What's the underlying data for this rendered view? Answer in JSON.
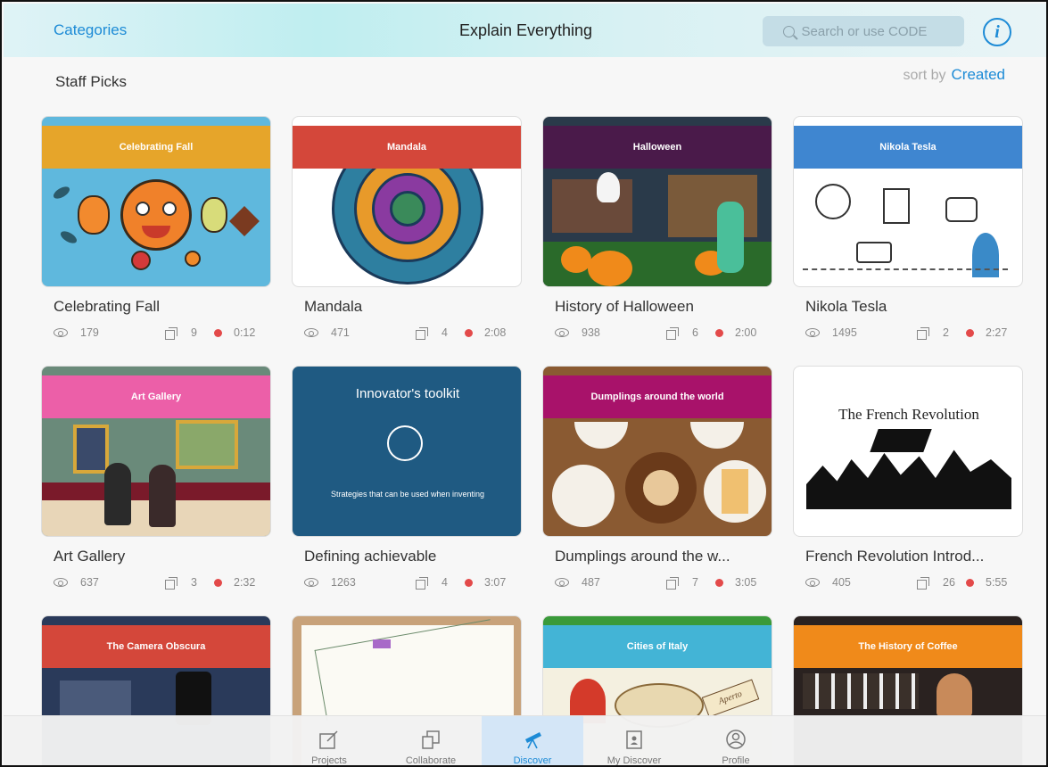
{
  "header": {
    "categories_label": "Categories",
    "title": "Explain Everything",
    "search_placeholder": "Search or use CODE"
  },
  "section": {
    "title": "Staff Picks",
    "sort_label": "sort by",
    "sort_value": "Created"
  },
  "cards": [
    {
      "banner": "Celebrating Fall",
      "title": "Celebrating Fall",
      "views": "179",
      "pages": "9",
      "duration": "0:12"
    },
    {
      "banner": "Mandala",
      "title": "Mandala",
      "views": "471",
      "pages": "4",
      "duration": "2:08"
    },
    {
      "banner": "Halloween",
      "title": "History of Halloween",
      "views": "938",
      "pages": "6",
      "duration": "2:00"
    },
    {
      "banner": "Nikola Tesla",
      "title": "Nikola Tesla",
      "views": "1495",
      "pages": "2",
      "duration": "2:27"
    },
    {
      "banner": "Art Gallery",
      "title": "Art Gallery",
      "views": "637",
      "pages": "3",
      "duration": "2:32"
    },
    {
      "banner": "Innovator's toolkit",
      "subtitle": "Strategies that can be used when inventing",
      "title": "Defining achievable",
      "views": "1263",
      "pages": "4",
      "duration": "3:07"
    },
    {
      "banner": "Dumplings around the world",
      "title": "Dumplings around the w...",
      "views": "487",
      "pages": "7",
      "duration": "3:05"
    },
    {
      "banner": "The French Revolution",
      "title": "French Revolution Introd...",
      "views": "405",
      "pages": "26",
      "duration": "5:55"
    },
    {
      "banner": "The Camera Obscura"
    },
    {
      "banner": ""
    },
    {
      "banner": "Cities of Italy",
      "sign": "Aperto"
    },
    {
      "banner": "The History of Coffee"
    }
  ],
  "tabs": [
    {
      "label": "Projects",
      "icon": "edit-icon"
    },
    {
      "label": "Collaborate",
      "icon": "collaborate-icon"
    },
    {
      "label": "Discover",
      "icon": "telescope-icon",
      "active": true
    },
    {
      "label": "My Discover",
      "icon": "folder-person-icon"
    },
    {
      "label": "Profile",
      "icon": "profile-icon"
    }
  ],
  "colors": {
    "accent": "#1d8bd6",
    "duration_dot": "#e34a4a"
  }
}
